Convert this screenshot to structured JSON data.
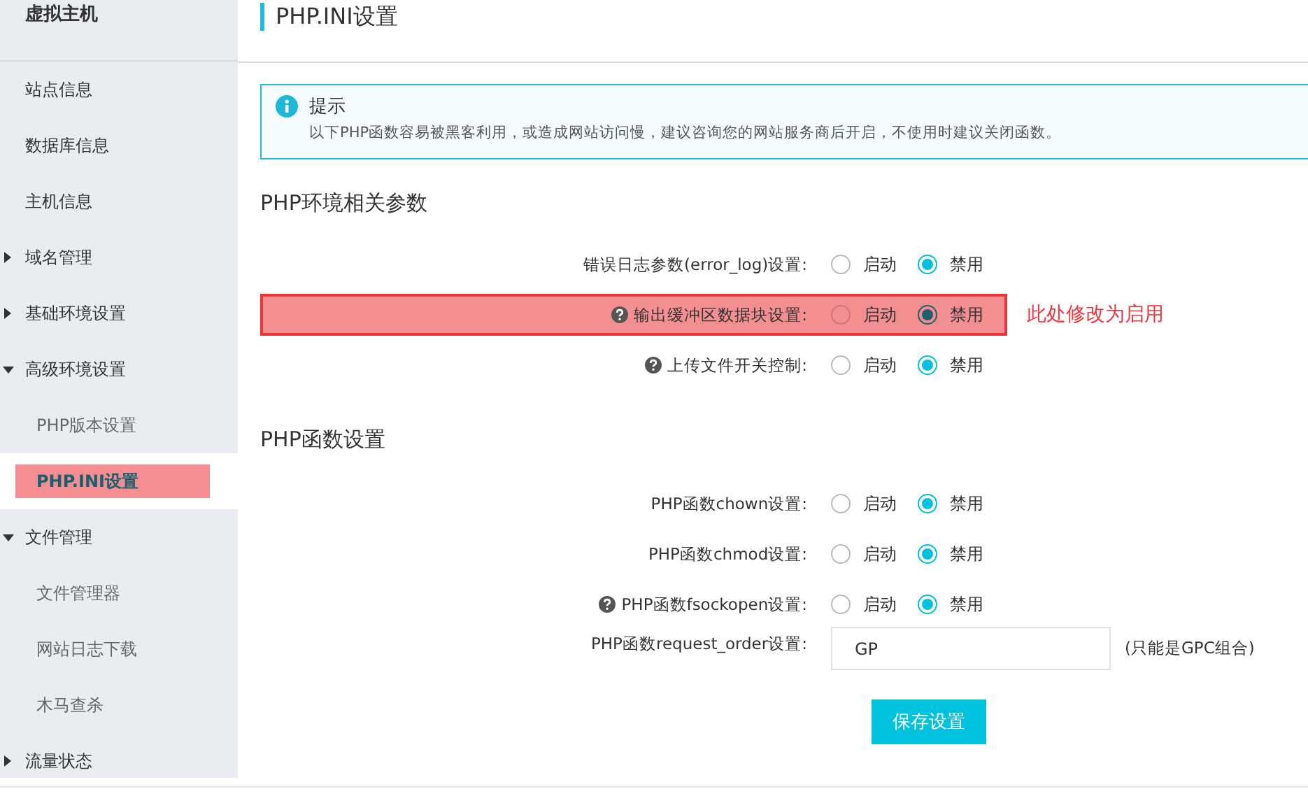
{
  "sidebar": {
    "title": "虚拟主机",
    "items": [
      {
        "label": "站点信息"
      },
      {
        "label": "数据库信息"
      },
      {
        "label": "主机信息"
      },
      {
        "label": "域名管理",
        "expanded": false
      },
      {
        "label": "基础环境设置",
        "expanded": false
      },
      {
        "label": "高级环境设置",
        "expanded": true,
        "children": [
          {
            "label": "PHP版本设置",
            "selected": false,
            "highlighted": false
          },
          {
            "label": "PHP.INI设置",
            "selected": true,
            "highlighted": true
          }
        ]
      },
      {
        "label": "文件管理",
        "expanded": true,
        "children": [
          {
            "label": "文件管理器",
            "selected": false,
            "highlighted": false
          },
          {
            "label": "网站日志下载",
            "selected": false,
            "highlighted": false
          },
          {
            "label": "木马查杀",
            "selected": false,
            "highlighted": false
          }
        ]
      },
      {
        "label": "流量状态",
        "expanded": false
      }
    ]
  },
  "page_title": "PHP.INI设置",
  "notice": {
    "title": "提示",
    "text": "以下PHP函数容易被黑客利用，或造成网站访问慢，建议咨询您的网站服务商后开启，不使用时建议关闭函数。"
  },
  "sections": [
    {
      "heading": "PHP环境相关参数",
      "rows": [
        {
          "kind": "radio",
          "label": "错误日志参数(error_log)设置:",
          "help": false,
          "highlighted": false,
          "options": [
            {
              "label": "启动",
              "selected": false
            },
            {
              "label": "禁用",
              "selected": true
            }
          ]
        },
        {
          "kind": "radio",
          "label": "输出缓冲区数据块设置:",
          "help": true,
          "highlighted": true,
          "annotation": "此处修改为启用",
          "options": [
            {
              "label": "启动",
              "selected": false
            },
            {
              "label": "禁用",
              "selected": true
            }
          ]
        },
        {
          "kind": "radio",
          "label": "上传文件开关控制:",
          "help": true,
          "highlighted": false,
          "options": [
            {
              "label": "启动",
              "selected": false
            },
            {
              "label": "禁用",
              "selected": true
            }
          ]
        }
      ]
    },
    {
      "heading": "PHP函数设置",
      "rows": [
        {
          "kind": "radio",
          "label": "PHP函数chown设置:",
          "help": false,
          "highlighted": false,
          "options": [
            {
              "label": "启动",
              "selected": false
            },
            {
              "label": "禁用",
              "selected": true
            }
          ]
        },
        {
          "kind": "radio",
          "label": "PHP函数chmod设置:",
          "help": false,
          "highlighted": false,
          "options": [
            {
              "label": "启动",
              "selected": false
            },
            {
              "label": "禁用",
              "selected": true
            }
          ]
        },
        {
          "kind": "radio",
          "label": "PHP函数fsockopen设置:",
          "help": true,
          "highlighted": false,
          "options": [
            {
              "label": "启动",
              "selected": false
            },
            {
              "label": "禁用",
              "selected": true
            }
          ]
        },
        {
          "kind": "input",
          "label": "PHP函数request_order设置:",
          "help": false,
          "highlighted": false,
          "value": "GP",
          "hint": "(只能是GPC组合)"
        }
      ]
    }
  ],
  "save_button": "保存设置"
}
